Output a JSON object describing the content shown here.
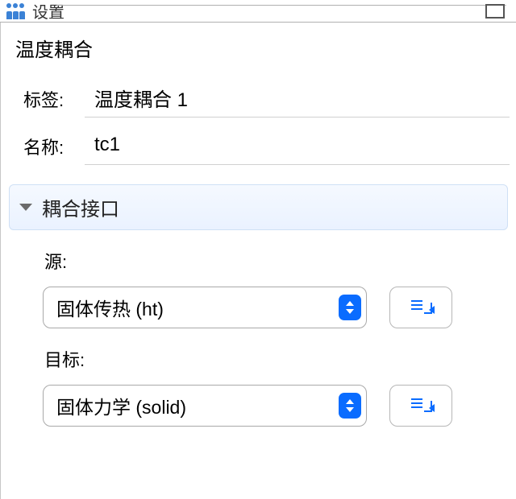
{
  "topbar": {
    "label": "设置"
  },
  "title": "温度耦合",
  "form": {
    "label_field_label": "标签:",
    "label_value": "温度耦合 1",
    "name_field_label": "名称:",
    "name_value": "tc1"
  },
  "section": {
    "header": "耦合接口",
    "source_label": "源:",
    "source_value": "固体传热 (ht)",
    "target_label": "目标:",
    "target_value": "固体力学 (solid)"
  }
}
